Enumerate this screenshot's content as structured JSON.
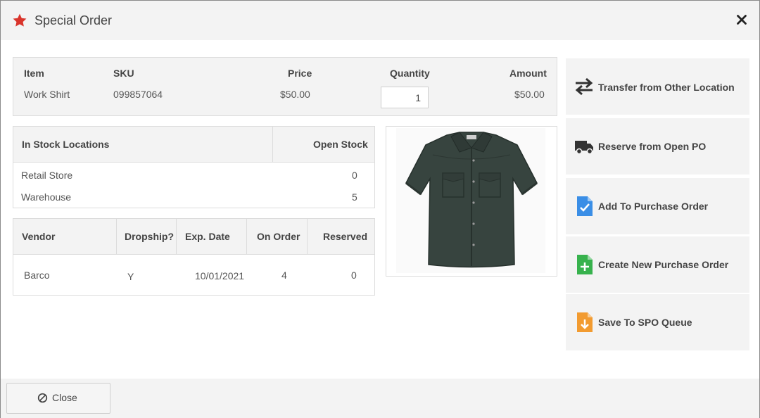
{
  "dialog": {
    "title": "Special Order"
  },
  "item": {
    "headers": {
      "item": "Item",
      "sku": "SKU",
      "price": "Price",
      "quantity": "Quantity",
      "amount": "Amount"
    },
    "name": "Work Shirt",
    "sku": "099857064",
    "price": "$50.00",
    "quantity": "1",
    "amount": "$50.00"
  },
  "stock": {
    "headers": {
      "location": "In Stock Locations",
      "open_stock": "Open Stock"
    },
    "rows": [
      {
        "location": "Retail Store",
        "open_stock": "0"
      },
      {
        "location": "Warehouse",
        "open_stock": "5"
      }
    ]
  },
  "vendor": {
    "headers": {
      "vendor": "Vendor",
      "dropship": "Dropship?",
      "exp_date": "Exp. Date",
      "on_order": "On Order",
      "reserved": "Reserved"
    },
    "rows": [
      {
        "vendor": "Barco",
        "dropship": "Y",
        "exp_date": "10/01/2021",
        "on_order": "4",
        "reserved": "0"
      }
    ]
  },
  "actions": {
    "transfer": "Transfer from Other Location",
    "reserve": "Reserve from Open PO",
    "add_po": "Add To Purchase Order",
    "create_po": "Create New Purchase Order",
    "save_queue": "Save To SPO Queue"
  },
  "footer": {
    "close_label": "Close"
  },
  "icons": {
    "title": "star-icon",
    "dismiss": "close-x-icon",
    "transfer": "transfer-arrows-icon",
    "reserve": "truck-icon",
    "add_po": "document-check-icon",
    "create_po": "document-plus-icon",
    "save_queue": "document-download-icon",
    "close": "ban-circle-icon"
  },
  "colors": {
    "star": "#d9342b",
    "doc_blue": "#3a8ee6",
    "doc_green": "#37b24d",
    "doc_orange": "#f29b30",
    "panel_bg": "#f3f3f3"
  }
}
